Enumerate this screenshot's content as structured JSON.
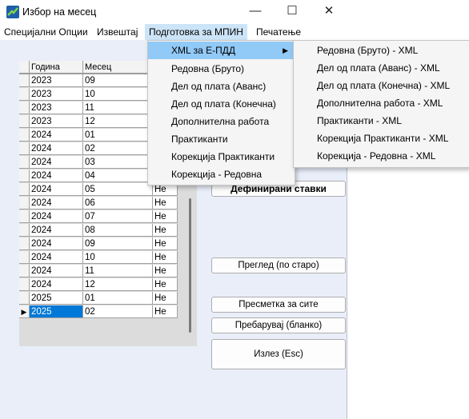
{
  "window": {
    "title": "Избор на месец",
    "minimize": "—",
    "maximize": "☐",
    "close": "✕"
  },
  "menu": [
    "Специјални Опции",
    "Извештај",
    "Подготовка за МПИН",
    "Печатење"
  ],
  "grid": {
    "headers": [
      "Година",
      "Месец"
    ],
    "rows": [
      {
        "year": "2023",
        "month": "09",
        "flag": ""
      },
      {
        "year": "2023",
        "month": "10",
        "flag": ""
      },
      {
        "year": "2023",
        "month": "11",
        "flag": ""
      },
      {
        "year": "2023",
        "month": "12",
        "flag": ""
      },
      {
        "year": "2024",
        "month": "01",
        "flag": ""
      },
      {
        "year": "2024",
        "month": "02",
        "flag": ""
      },
      {
        "year": "2024",
        "month": "03",
        "flag": ""
      },
      {
        "year": "2024",
        "month": "04",
        "flag": ""
      },
      {
        "year": "2024",
        "month": "05",
        "flag": "Не"
      },
      {
        "year": "2024",
        "month": "06",
        "flag": "Не"
      },
      {
        "year": "2024",
        "month": "07",
        "flag": "Не"
      },
      {
        "year": "2024",
        "month": "08",
        "flag": "Не"
      },
      {
        "year": "2024",
        "month": "09",
        "flag": "Не"
      },
      {
        "year": "2024",
        "month": "10",
        "flag": "Не"
      },
      {
        "year": "2024",
        "month": "11",
        "flag": "Не"
      },
      {
        "year": "2024",
        "month": "12",
        "flag": "Не"
      },
      {
        "year": "2025",
        "month": "01",
        "flag": "Не"
      },
      {
        "year": "2025",
        "month": "02",
        "flag": "Не"
      }
    ]
  },
  "buttons": {
    "defined": "Дефинирани ставки",
    "preview": "Преглед (по старо)",
    "calc_all": "Пресметка за сите",
    "search": "Пребарувај (бланко)",
    "exit": "Излез (Esc)"
  },
  "dropdown": {
    "items": [
      "XML за Е-ПДД",
      "Редовна (Бруто)",
      "Дел од плата (Аванс)",
      "Дел од плата (Конечна)",
      "Дополнителна работа",
      "Практиканти",
      "Корекција Практиканти",
      "Корекција - Редовна"
    ]
  },
  "submenu": {
    "items": [
      "Редовна (Бруто) - XML",
      "Дел од плата (Аванс) - XML",
      "Дел од плата (Конечна) - XML",
      "Дополнителна работа - XML",
      "Практиканти - XML",
      "Корекција Практиканти - XML",
      "Корекција - Редовна - XML"
    ]
  },
  "colors": {
    "window_bg": "#e9eef9",
    "selection": "#0078d7",
    "menu_highlight": "#91c9f7"
  }
}
